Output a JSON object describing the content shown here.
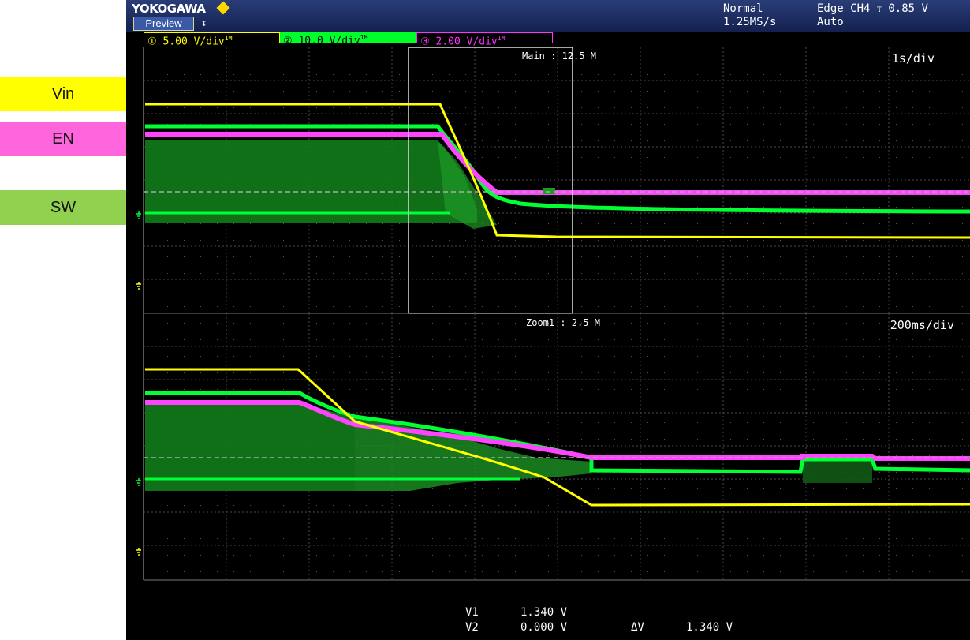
{
  "legend": {
    "vin": {
      "label": "Vin",
      "color": "#ffff00"
    },
    "en": {
      "label": "EN",
      "color": "#ff66dd"
    },
    "sw": {
      "label": "SW",
      "color": "#92d050"
    }
  },
  "header": {
    "brand": "YOKOGAWA",
    "preview_label": "Preview",
    "acquisition_mode": "Normal",
    "sample_rate": "1.25MS/s",
    "trigger": "Edge CH4 ⲧ 0.85 V",
    "trigger_mode": "Auto"
  },
  "channels": [
    {
      "id": "ch1",
      "label": "① 5.00 V/div",
      "suffix": "1M",
      "color": "#ffff00"
    },
    {
      "id": "ch2",
      "label": "② 10.0 V/div",
      "suffix": "1M",
      "color": "#00ff2a"
    },
    {
      "id": "ch3",
      "label": "③ 2.00 V/div",
      "suffix": "1M",
      "color": "#ff33ff"
    }
  ],
  "main_window": {
    "label": "Main : 12.5 M",
    "timebase": "1s/div"
  },
  "zoom_window": {
    "label": "Zoom1 : 2.5 M",
    "timebase": "200ms/div"
  },
  "cursor_readout": {
    "v1_label": "V1",
    "v1_value": "1.340 V",
    "v2_label": "V2",
    "v2_value": "0.000 V",
    "dv_label": "ΔV",
    "dv_value": "1.340 V"
  }
}
